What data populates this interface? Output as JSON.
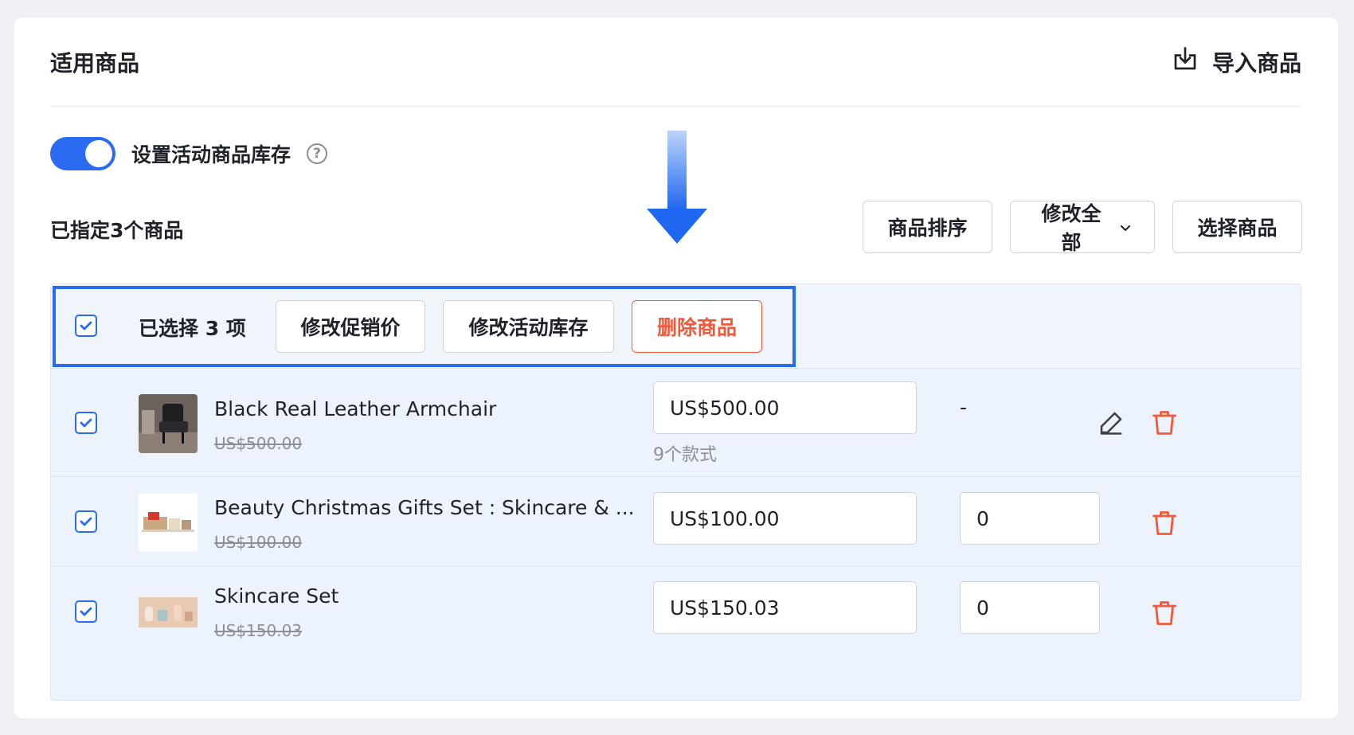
{
  "header": {
    "title": "适用商品",
    "import_label": "导入商品"
  },
  "stock_setting": {
    "label": "设置活动商品库存",
    "enabled": true,
    "help_glyph": "?"
  },
  "assigned_count": "已指定3个商品",
  "toolbar": {
    "sort_label": "商品排序",
    "edit_all_label": "修改全部",
    "select_label": "选择商品"
  },
  "bulk_bar": {
    "selected_text": "已选择 3 项",
    "edit_price_label": "修改促销价",
    "edit_stock_label": "修改活动库存",
    "delete_label": "删除商品"
  },
  "products": [
    {
      "name": "Black Real Leather Armchair",
      "original_price": "US$500.00",
      "promo_price": "US$500.00",
      "variants": "9个款式",
      "stock": "-"
    },
    {
      "name": "Beauty Christmas Gifts Set : Skincare & ...",
      "original_price": "US$100.00",
      "promo_price": "US$100.00",
      "stock": "0"
    },
    {
      "name": "Skincare Set",
      "original_price": "US$150.03",
      "promo_price": "US$150.03",
      "stock": "0"
    }
  ],
  "colors": {
    "accent": "#2a6bf2",
    "danger": "#f05a3a"
  }
}
